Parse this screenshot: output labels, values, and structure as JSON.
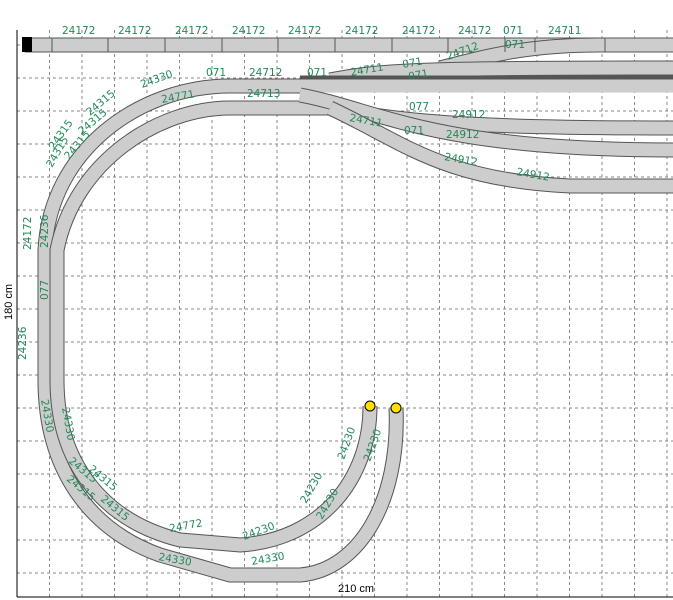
{
  "dimensions": {
    "width_label": "210 cm",
    "height_label": "180 cm"
  },
  "colors": {
    "track_fill": "#cdcdcd",
    "track_edge": "#555555",
    "label": "#1f8a57",
    "end_marker": "#ffe000",
    "grid": "#8a8a8a"
  },
  "labels": [
    "24172",
    "24172",
    "24172",
    "24172",
    "24172",
    "24172",
    "24172",
    "24172",
    "071",
    "24711",
    "24712",
    "071",
    "24330",
    "071",
    "24712",
    "071",
    "24711",
    "071",
    "071",
    "24771",
    "24713",
    "24711",
    "077",
    "24912",
    "071",
    "24912",
    "24912",
    "24912",
    "24315",
    "24315",
    "24315",
    "24315",
    "24315",
    "24172",
    "24236",
    "077",
    "24236",
    "24330",
    "24330",
    "24315",
    "24315",
    "24315",
    "24315",
    "24772",
    "24230",
    "24230",
    "24230",
    "24330",
    "24330",
    "24230",
    "24230"
  ]
}
